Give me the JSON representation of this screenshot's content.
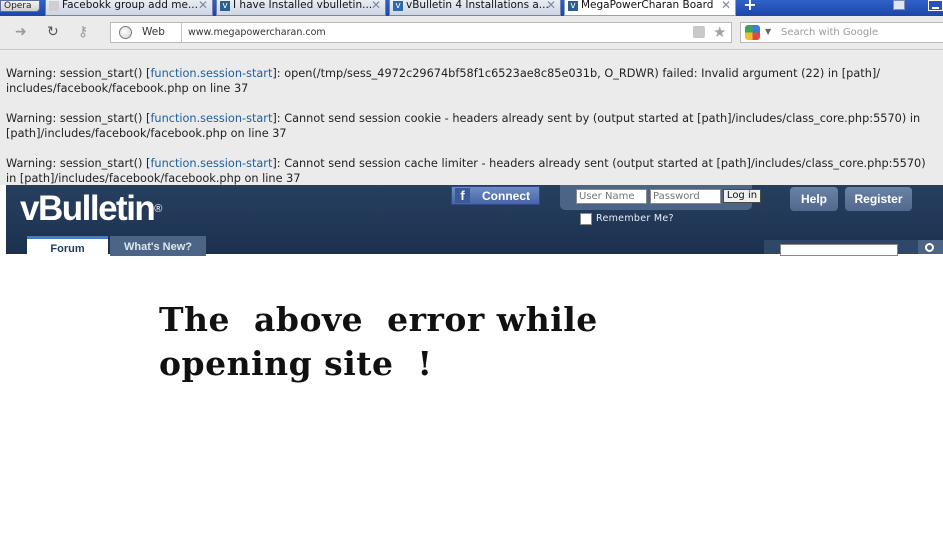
{
  "browser": {
    "opera_menu_label": "Opera",
    "tabs": [
      {
        "label": "Facebokk group add me...",
        "favicon": "document-icon"
      },
      {
        "label": "I have Installed vbulletin...",
        "favicon": "vb-icon"
      },
      {
        "label": "vBulletin 4 Installations a...",
        "favicon": "vb-icon"
      },
      {
        "label": "MegaPowerCharan Board",
        "favicon": "vb-icon",
        "active": true
      }
    ],
    "address_bar": {
      "zone_label": "Web",
      "url": "www.megapowercharan.com"
    },
    "search_box": {
      "placeholder": "Search with Google"
    }
  },
  "warnings": [
    {
      "prefix": "Warning: session_start() [",
      "link": "function.session-start",
      "line1_rest": "]: open(/tmp/sess_4972c29674bf58f1c6523ae8c85e031b, O_RDWR) failed: Invalid argument (22) in [path]/",
      "line2": "includes/facebook/facebook.php on line 37"
    },
    {
      "prefix": "Warning: session_start() [",
      "link": "function.session-start",
      "line1_rest": "]: Cannot send session cookie - headers already sent by (output started at [path]/includes/class_core.php:5570) in",
      "line2": "[path]/includes/facebook/facebook.php on line 37"
    },
    {
      "prefix": "Warning: session_start() [",
      "link": "function.session-start",
      "line1_rest": "]: Cannot send session cache limiter - headers already sent (output started at [path]/includes/class_core.php:5570)",
      "line2": "in [path]/includes/facebook/facebook.php on line 37"
    }
  ],
  "vbulletin": {
    "logo_text": "vBulletin",
    "logo_reg": "®",
    "facebook_connect_label": "Connect",
    "login": {
      "username_placeholder": "User Name",
      "password_placeholder": "Password",
      "login_button": "Log in",
      "remember_me": "Remember Me?"
    },
    "header_buttons": {
      "help": "Help",
      "register": "Register"
    },
    "tabs": {
      "forum": "Forum",
      "whats_new": "What's New?"
    }
  },
  "annotation": {
    "line1": "The  above  error while",
    "line2": "opening site  !"
  },
  "colors": {
    "tabbar": "#1f4fb5",
    "vb_header": "#243a58",
    "link": "#1f5fa0"
  }
}
